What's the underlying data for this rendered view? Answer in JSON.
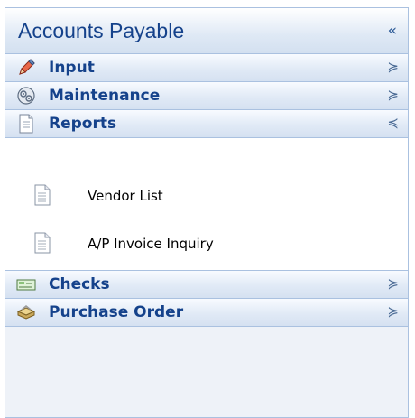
{
  "panel": {
    "title": "Accounts Payable",
    "collapse_glyph": "«"
  },
  "groups": [
    {
      "label": "Input",
      "icon": "pencil-icon",
      "chevron": "≽",
      "expanded": false
    },
    {
      "label": "Maintenance",
      "icon": "gear-icon",
      "chevron": "≽",
      "expanded": false
    },
    {
      "label": "Reports",
      "icon": "document-icon",
      "chevron": "≼",
      "expanded": true
    },
    {
      "label": "Checks",
      "icon": "check-icon",
      "chevron": "≽",
      "expanded": false
    },
    {
      "label": "Purchase Order",
      "icon": "purchase-order-icon",
      "chevron": "≽",
      "expanded": false
    }
  ],
  "reports_items": [
    {
      "label": "Vendor List",
      "icon": "document-icon"
    },
    {
      "label": "A/P Invoice Inquiry",
      "icon": "document-icon"
    }
  ],
  "colors": {
    "title_text": "#15428b",
    "border": "#aac1e0",
    "panel_bg": "#eef2f8"
  }
}
